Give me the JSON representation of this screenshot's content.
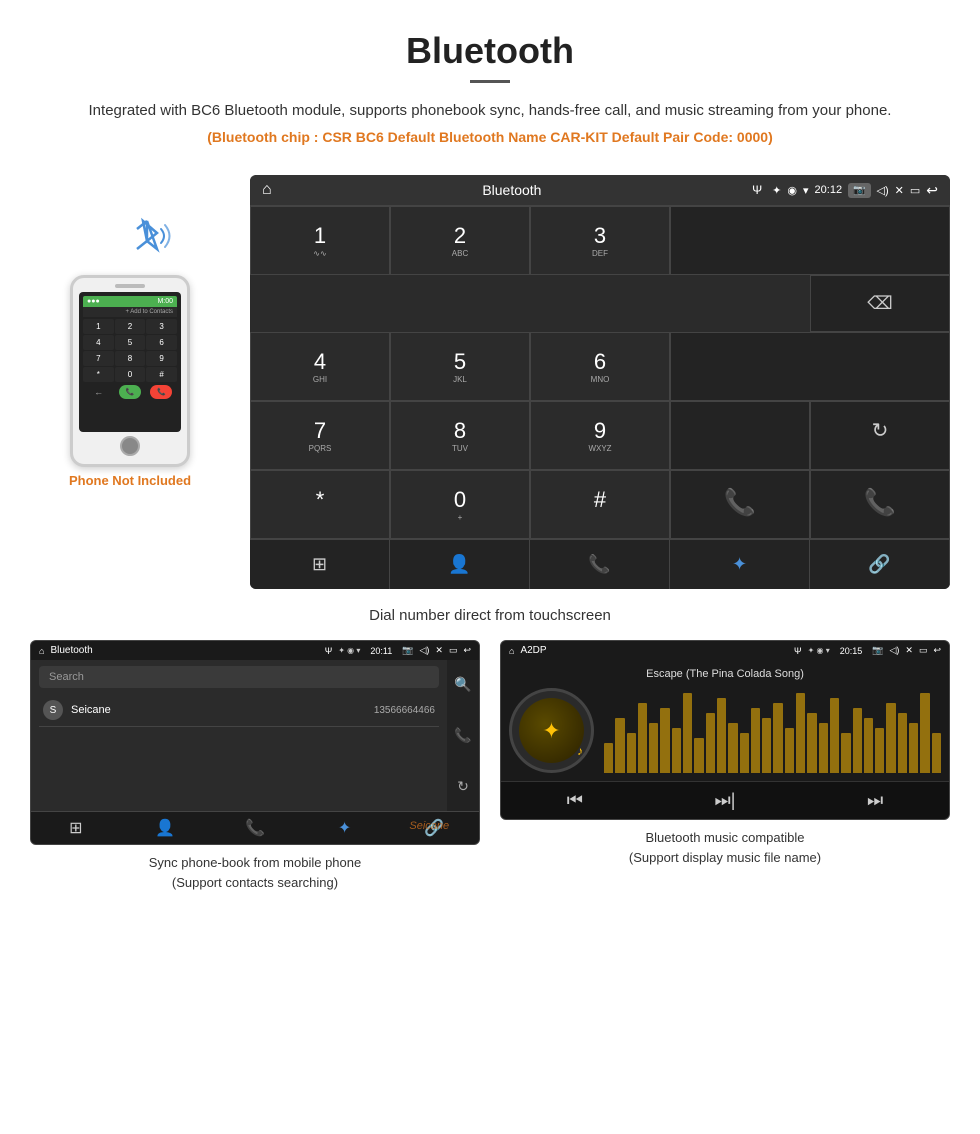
{
  "header": {
    "title": "Bluetooth",
    "description": "Integrated with BC6 Bluetooth module, supports phonebook sync, hands-free call, and music streaming from your phone.",
    "specs": "(Bluetooth chip : CSR BC6    Default Bluetooth Name CAR-KIT    Default Pair Code: 0000)"
  },
  "phone_label": "Phone Not Included",
  "dialer": {
    "status_bar": {
      "home_icon": "⌂",
      "title": "Bluetooth",
      "usb_icon": "Ψ",
      "bt_icon": "✦",
      "location_icon": "◉",
      "signal_icon": "▾",
      "time": "20:12",
      "camera_icon": "📷",
      "volume_icon": "◁)",
      "close_icon": "✕",
      "window_icon": "▭",
      "back_icon": "↩"
    },
    "keys": [
      {
        "digit": "1",
        "sub": "∿∿",
        "col": 1
      },
      {
        "digit": "2",
        "sub": "ABC",
        "col": 2
      },
      {
        "digit": "3",
        "sub": "DEF",
        "col": 3
      },
      {
        "digit": "4",
        "sub": "GHI",
        "col": 1
      },
      {
        "digit": "5",
        "sub": "JKL",
        "col": 2
      },
      {
        "digit": "6",
        "sub": "MNO",
        "col": 3
      },
      {
        "digit": "7",
        "sub": "PQRS",
        "col": 1
      },
      {
        "digit": "8",
        "sub": "TUV",
        "col": 2
      },
      {
        "digit": "9",
        "sub": "WXYZ",
        "col": 3
      },
      {
        "digit": "*",
        "sub": "",
        "col": 1
      },
      {
        "digit": "0",
        "sub": "+",
        "col": 2
      },
      {
        "digit": "#",
        "sub": "",
        "col": 3
      }
    ],
    "bottom_icons": [
      "⊞",
      "👤",
      "📞",
      "✦",
      "🔗"
    ]
  },
  "caption": "Dial number direct from touchscreen",
  "phonebook": {
    "status_title": "Bluetooth",
    "time": "20:11",
    "search_placeholder": "Search",
    "contact_name": "Seicane",
    "contact_number": "13566664466",
    "contact_initial": "S",
    "bottom_icons": [
      "⊞",
      "👤",
      "📞",
      "✦",
      "🔗"
    ]
  },
  "music": {
    "status_title": "A2DP",
    "time": "20:15",
    "song_title": "Escape (The Pina Colada Song)",
    "visualizer_bars": [
      30,
      55,
      40,
      70,
      50,
      65,
      45,
      80,
      35,
      60,
      75,
      50,
      40,
      65,
      55,
      70,
      45,
      80,
      60,
      50,
      75,
      40,
      65,
      55,
      45,
      70,
      60,
      50,
      80,
      40
    ],
    "bottom_icons": [
      "⏮",
      "⏭|",
      "⏭"
    ]
  },
  "captions": {
    "phonebook": "Sync phone-book from mobile phone\n(Support contacts searching)",
    "music": "Bluetooth music compatible\n(Support display music file name)"
  },
  "watermark": "Seicane"
}
